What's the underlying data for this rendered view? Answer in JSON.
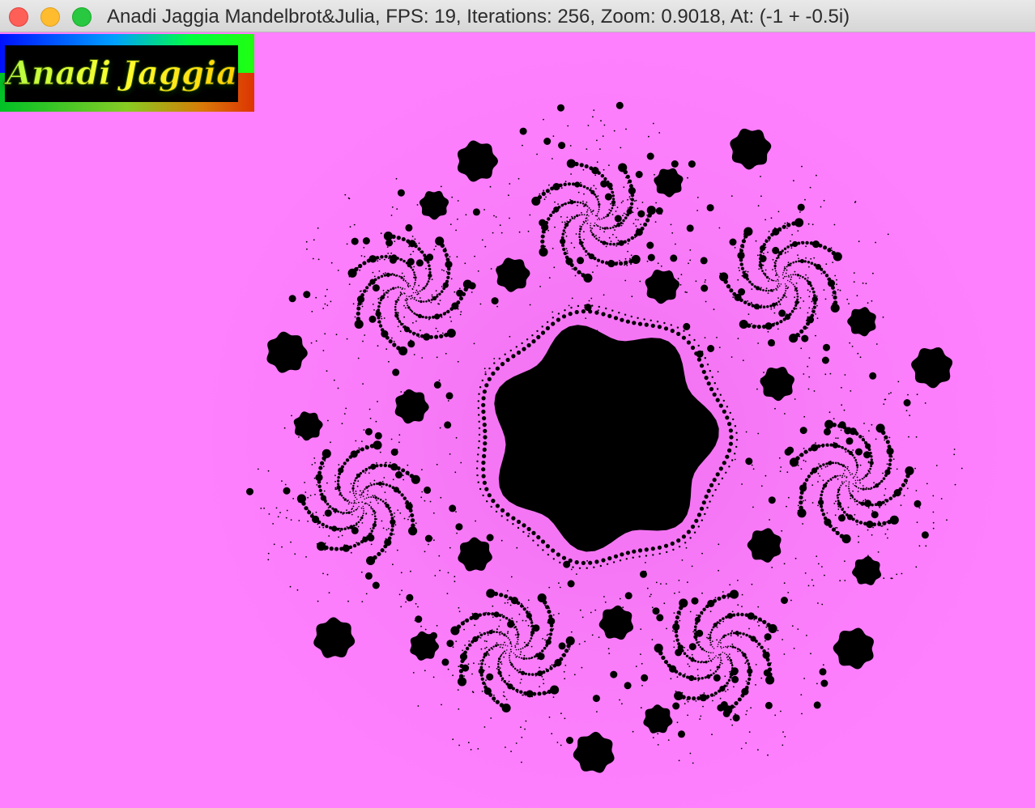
{
  "window": {
    "title": "Anadi Jaggia Mandelbrot&Julia, FPS: 19, Iterations: 256, Zoom: 0.9018, At: (-1 + -0.5i)",
    "controls": {
      "close": "close-icon",
      "minimize": "minimize-icon",
      "zoom": "zoom-icon"
    }
  },
  "logo": {
    "text": "Anadi Jaggia"
  },
  "render": {
    "fractal": "Julia",
    "fps": 19,
    "iterations": 256,
    "zoom": 0.9018,
    "c_real": -1,
    "c_imag": -0.5
  },
  "colors": {
    "background": "#ff80ff",
    "interior": "#000000",
    "glow": "#f070f0"
  }
}
